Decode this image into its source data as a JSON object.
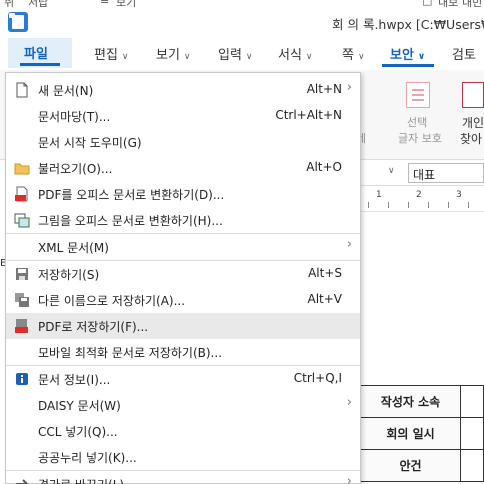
{
  "window": {
    "title": "회 의 록.hwpx [C:₩Users₩",
    "top_fragments": [
      "쥐",
      "서랍",
      "≡",
      "보기",
      "□",
      "내보",
      "내빈"
    ]
  },
  "menubar": {
    "items": [
      {
        "label": "파일"
      },
      {
        "label": "편집"
      },
      {
        "label": "보기"
      },
      {
        "label": "입력"
      },
      {
        "label": "서식"
      },
      {
        "label": "쪽"
      },
      {
        "label": "보안"
      },
      {
        "label": "검토"
      }
    ]
  },
  "ribbon": {
    "select_label": "선택",
    "select_sub": "글자 보호",
    "personal_label": "개인",
    "personal_sub": "찾아",
    "cut_label": "제"
  },
  "toolbar": {
    "style_value": "대표"
  },
  "ruler": {
    "marks": [
      "1",
      "2",
      "3"
    ]
  },
  "doc_table": {
    "rows": [
      "작성자 소속",
      "회의 일시",
      "안건"
    ]
  },
  "side_mark": "E",
  "file_menu": {
    "items": [
      {
        "label": "새 문서(N)",
        "shortcut": "Alt+N",
        "submenu": true,
        "icon": "new-document-icon"
      },
      {
        "label": "문서마당(T)...",
        "shortcut": "Ctrl+Alt+N",
        "submenu": false,
        "icon": ""
      },
      {
        "label": "문서 시작 도우미(G)",
        "shortcut": "",
        "submenu": false,
        "icon": ""
      },
      {
        "label": "불러오기(O)...",
        "shortcut": "Alt+O",
        "submenu": false,
        "icon": "folder-icon"
      },
      {
        "label": "PDF를 오피스 문서로 변환하기(D)...",
        "shortcut": "",
        "submenu": false,
        "icon": "pdf-convert-icon"
      },
      {
        "label": "그림을 오피스 문서로 변환하기(H)...",
        "shortcut": "",
        "submenu": false,
        "icon": "image-convert-icon"
      },
      {
        "label": "XML 문서(M)",
        "shortcut": "",
        "submenu": true,
        "icon": ""
      },
      {
        "label": "저장하기(S)",
        "shortcut": "Alt+S",
        "submenu": false,
        "icon": "save-icon"
      },
      {
        "label": "다른 이름으로 저장하기(A)...",
        "shortcut": "Alt+V",
        "submenu": false,
        "icon": "save-as-icon"
      },
      {
        "label": "PDF로 저장하기(F)...",
        "shortcut": "",
        "submenu": false,
        "icon": "save-pdf-icon"
      },
      {
        "label": "모바일 최적화 문서로 저장하기(B)...",
        "shortcut": "",
        "submenu": false,
        "icon": ""
      },
      {
        "label": "문서 정보(I)...",
        "shortcut": "Ctrl+Q,I",
        "submenu": false,
        "icon": "info-icon"
      },
      {
        "label": "DAISY 문서(W)",
        "shortcut": "",
        "submenu": true,
        "icon": ""
      },
      {
        "label": "CCL 넣기(Q)...",
        "shortcut": "",
        "submenu": false,
        "icon": ""
      },
      {
        "label": "공공누리 넣기(K)...",
        "shortcut": "",
        "submenu": false,
        "icon": ""
      },
      {
        "label": "경가로 바꾸기(L)",
        "shortcut": "",
        "submenu": true,
        "icon": "arrow-icon"
      }
    ]
  },
  "colors": {
    "accent": "#1565c0",
    "hover": "#e9e9e9"
  }
}
